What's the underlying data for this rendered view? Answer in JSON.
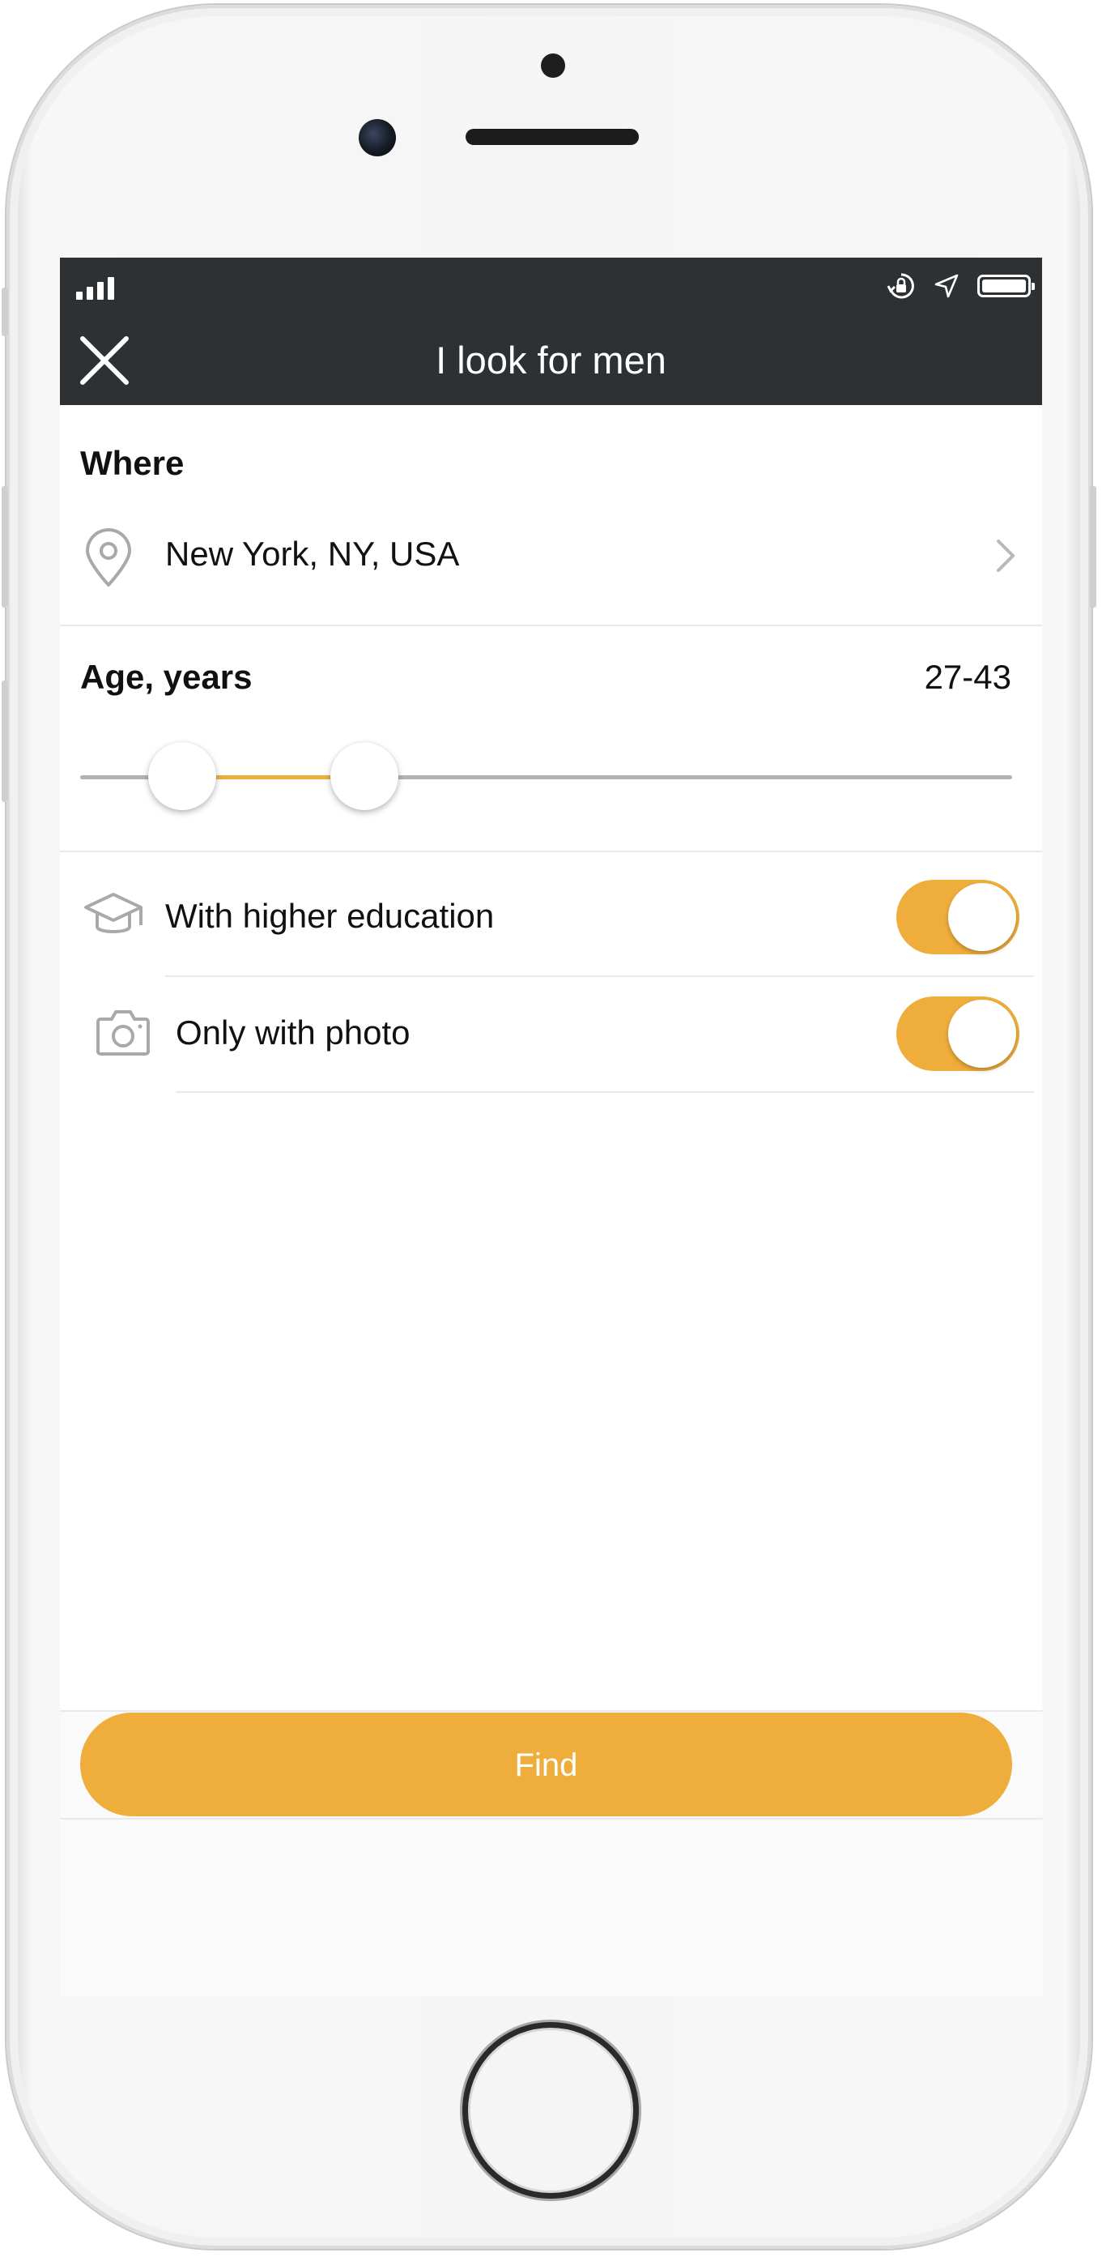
{
  "device": {
    "type": "iphone"
  },
  "status_bar": {
    "icons": [
      "signal-icon",
      "orientation-lock-icon",
      "location-icon",
      "battery-icon"
    ]
  },
  "header": {
    "title": "I look for men",
    "close_icon": "close-icon"
  },
  "where": {
    "label": "Where",
    "location": "New York, NY, USA",
    "icon": "location-pin-icon"
  },
  "age": {
    "label": "Age, years",
    "value_text": "27-43",
    "min_value": 27,
    "max_value": 43
  },
  "filters": [
    {
      "label": "With higher education",
      "icon": "graduation-cap-icon",
      "enabled": true
    },
    {
      "label": "Only with photo",
      "icon": "camera-icon",
      "enabled": true
    }
  ],
  "find_button": {
    "label": "Find"
  },
  "colors": {
    "accent": "#efae3c",
    "header_bg": "#2e3134",
    "text": "#111111"
  }
}
